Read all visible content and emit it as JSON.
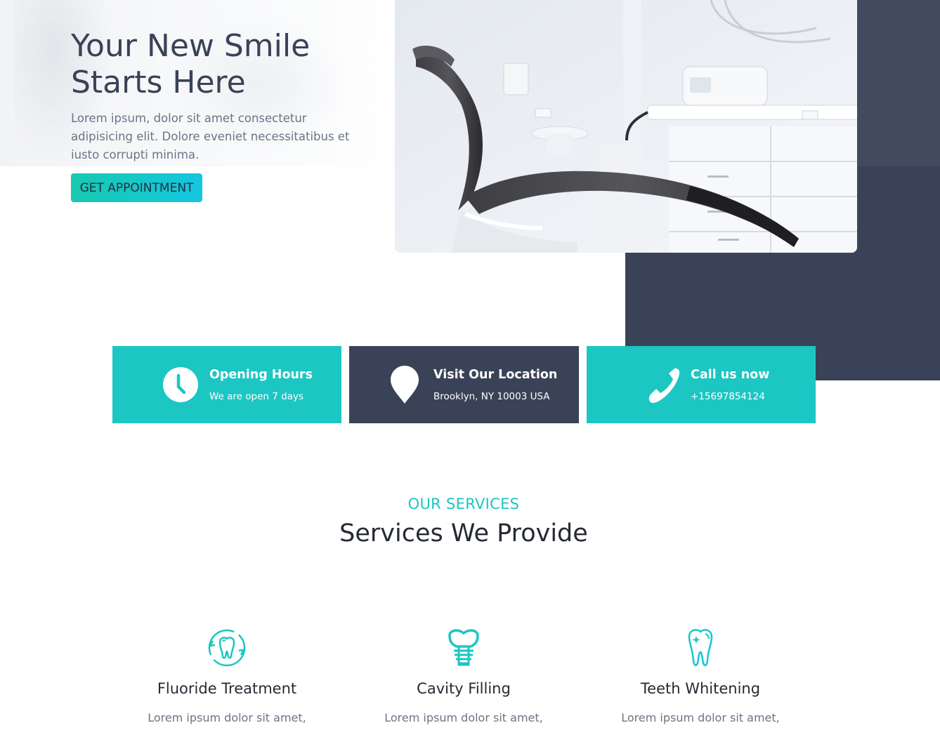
{
  "hero": {
    "title": "Your New Smile Starts Here",
    "subtitle": "Lorem ipsum, dolor sit amet consectetur adipisicing elit. Dolore eveniet necessitatibus et iusto corrupti minima.",
    "cta_label": "GET APPOINTMENT",
    "image_icon": "dental-chair-photo"
  },
  "info_cards": [
    {
      "icon": "clock-icon",
      "title": "Opening Hours",
      "subtitle": "We are open 7 days"
    },
    {
      "icon": "location-pin-icon",
      "title": "Visit Our Location",
      "subtitle": "Brooklyn, NY 10003 USA"
    },
    {
      "icon": "phone-icon",
      "title": "Call us now",
      "subtitle": "+15697854124"
    }
  ],
  "services": {
    "kicker": "OUR SERVICES",
    "title": "Services We Provide",
    "items": [
      {
        "icon": "fluoride-tooth-icon",
        "name": "Fluoride Treatment",
        "desc": "Lorem ipsum dolor sit amet,"
      },
      {
        "icon": "implant-tooth-icon",
        "name": "Cavity Filling",
        "desc": "Lorem ipsum dolor sit amet,"
      },
      {
        "icon": "sparkle-tooth-icon",
        "name": "Teeth Whitening",
        "desc": "Lorem ipsum dolor sit amet,"
      }
    ]
  },
  "colors": {
    "accent": "#1cc6c2",
    "dark": "#3a4257",
    "heading": "#262a33",
    "body_text": "#6c7385"
  }
}
